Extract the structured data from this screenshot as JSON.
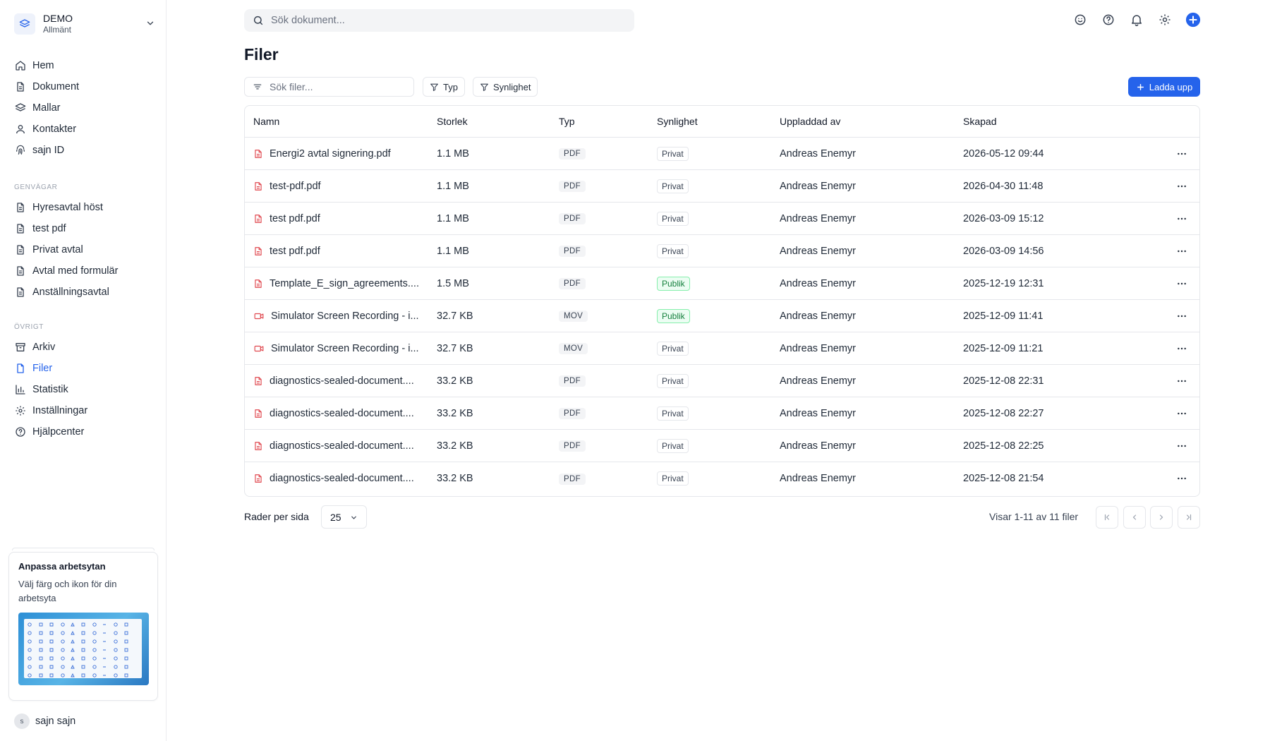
{
  "workspace": {
    "name": "DEMO",
    "subtitle": "Allmänt"
  },
  "nav_main": [
    {
      "label": "Hem",
      "icon": "home-icon"
    },
    {
      "label": "Dokument",
      "icon": "document-icon"
    },
    {
      "label": "Mallar",
      "icon": "layers-icon"
    },
    {
      "label": "Kontakter",
      "icon": "user-icon"
    },
    {
      "label": "sajn ID",
      "icon": "fingerprint-icon"
    }
  ],
  "shortcuts": {
    "label": "GENVÄGAR",
    "items": [
      {
        "label": "Hyresavtal höst"
      },
      {
        "label": "test pdf"
      },
      {
        "label": "Privat avtal"
      },
      {
        "label": "Avtal med formulär"
      },
      {
        "label": "Anställningsavtal"
      }
    ]
  },
  "other": {
    "label": "ÖVRIGT",
    "items": [
      {
        "label": "Arkiv",
        "icon": "archive-icon"
      },
      {
        "label": "Filer",
        "icon": "file-icon",
        "active": true
      },
      {
        "label": "Statistik",
        "icon": "bar-chart-icon"
      },
      {
        "label": "Inställningar",
        "icon": "gear-icon"
      },
      {
        "label": "Hjälpcenter",
        "icon": "help-icon"
      }
    ]
  },
  "promo": {
    "title": "Anpassa arbetsytan",
    "description": "Välj färg och ikon för din arbetsyta"
  },
  "user": {
    "initial": "s",
    "name": "sajn sajn"
  },
  "top_search": {
    "placeholder": "Sök dokument..."
  },
  "page": {
    "title": "Filer"
  },
  "toolbar": {
    "filter_placeholder": "Sök filer...",
    "type_filter": "Typ",
    "visibility_filter": "Synlighet",
    "upload_label": "Ladda upp"
  },
  "table": {
    "headers": {
      "name": "Namn",
      "size": "Storlek",
      "type": "Typ",
      "visibility": "Synlighet",
      "uploaded_by": "Uppladdad av",
      "created": "Skapad"
    },
    "rows": [
      {
        "name": "Energi2 avtal signering.pdf",
        "kind": "pdf",
        "size": "1.1 MB",
        "type": "PDF",
        "visibility": "Privat",
        "uploaded_by": "Andreas Enemyr",
        "created": "2026-05-12 09:44"
      },
      {
        "name": "test-pdf.pdf",
        "kind": "pdf",
        "size": "1.1 MB",
        "type": "PDF",
        "visibility": "Privat",
        "uploaded_by": "Andreas Enemyr",
        "created": "2026-04-30 11:48"
      },
      {
        "name": "test pdf.pdf",
        "kind": "pdf",
        "size": "1.1 MB",
        "type": "PDF",
        "visibility": "Privat",
        "uploaded_by": "Andreas Enemyr",
        "created": "2026-03-09 15:12"
      },
      {
        "name": "test pdf.pdf",
        "kind": "pdf",
        "size": "1.1 MB",
        "type": "PDF",
        "visibility": "Privat",
        "uploaded_by": "Andreas Enemyr",
        "created": "2026-03-09 14:56"
      },
      {
        "name": "Template_E_sign_agreements....",
        "kind": "pdf",
        "size": "1.5 MB",
        "type": "PDF",
        "visibility": "Publik",
        "uploaded_by": "Andreas Enemyr",
        "created": "2025-12-19 12:31"
      },
      {
        "name": "Simulator Screen Recording - i...",
        "kind": "video",
        "size": "32.7 KB",
        "type": "MOV",
        "visibility": "Publik",
        "uploaded_by": "Andreas Enemyr",
        "created": "2025-12-09 11:41"
      },
      {
        "name": "Simulator Screen Recording - i...",
        "kind": "video",
        "size": "32.7 KB",
        "type": "MOV",
        "visibility": "Privat",
        "uploaded_by": "Andreas Enemyr",
        "created": "2025-12-09 11:21"
      },
      {
        "name": "diagnostics-sealed-document....",
        "kind": "pdf",
        "size": "33.2 KB",
        "type": "PDF",
        "visibility": "Privat",
        "uploaded_by": "Andreas Enemyr",
        "created": "2025-12-08 22:31"
      },
      {
        "name": "diagnostics-sealed-document....",
        "kind": "pdf",
        "size": "33.2 KB",
        "type": "PDF",
        "visibility": "Privat",
        "uploaded_by": "Andreas Enemyr",
        "created": "2025-12-08 22:27"
      },
      {
        "name": "diagnostics-sealed-document....",
        "kind": "pdf",
        "size": "33.2 KB",
        "type": "PDF",
        "visibility": "Privat",
        "uploaded_by": "Andreas Enemyr",
        "created": "2025-12-08 22:25"
      },
      {
        "name": "diagnostics-sealed-document....",
        "kind": "pdf",
        "size": "33.2 KB",
        "type": "PDF",
        "visibility": "Privat",
        "uploaded_by": "Andreas Enemyr",
        "created": "2025-12-08 21:54"
      }
    ]
  },
  "pagination": {
    "rows_label": "Rader per sida",
    "rows_per_page": "25",
    "status": "Visar 1-11 av 11 filer"
  },
  "colors": {
    "accent": "#2563eb",
    "file_icon": "#e0484f",
    "public_badge": "#15803d"
  }
}
